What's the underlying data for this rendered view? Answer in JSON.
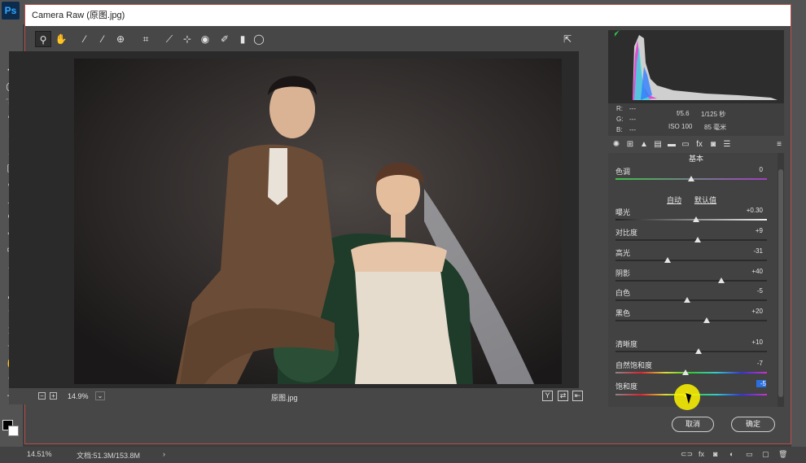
{
  "app": {
    "logo": "Ps",
    "window_title": "Camera Raw (原图.jpg)"
  },
  "ps_status": {
    "zoom": "14.51%",
    "doc": "文档:51.3M/153.8M"
  },
  "toolbar": {
    "icons": [
      "zoom-icon",
      "hand-icon",
      "white-balance-icon",
      "color-sampler-icon",
      "target-adjust-icon",
      "crop-icon",
      "straighten-icon",
      "spot-removal-icon",
      "red-eye-icon",
      "brush-icon",
      "gradient-filter-icon",
      "radial-filter-icon"
    ]
  },
  "status": {
    "zoom_value": "14.9%",
    "filename": "原图.jpg"
  },
  "exif": {
    "r_label": "R:",
    "g_label": "G:",
    "b_label": "B:",
    "dash": "---",
    "aperture": "f/5.6",
    "shutter": "1/125 秒",
    "iso": "ISO 100",
    "focal": "85 毫米"
  },
  "panel": {
    "title": "基本",
    "auto": "自动",
    "default": "默认值",
    "tint": {
      "label": "色调",
      "value": "0",
      "pos": 0.5
    },
    "exposure": {
      "label": "曝光",
      "value": "+0.30",
      "pos": 0.53
    },
    "contrast": {
      "label": "对比度",
      "value": "+9",
      "pos": 0.545
    },
    "highlights": {
      "label": "高光",
      "value": "-31",
      "pos": 0.345
    },
    "shadows": {
      "label": "阴影",
      "value": "+40",
      "pos": 0.7
    },
    "whites": {
      "label": "白色",
      "value": "-5",
      "pos": 0.475
    },
    "blacks": {
      "label": "黑色",
      "value": "+20",
      "pos": 0.6
    },
    "clarity": {
      "label": "清晰度",
      "value": "+10",
      "pos": 0.55
    },
    "vibrance": {
      "label": "自然饱和度",
      "value": "-7",
      "pos": 0.465
    },
    "saturation": {
      "label": "饱和度",
      "value": "-5",
      "pos": 0.475
    }
  },
  "buttons": {
    "cancel": "取消",
    "ok": "确定"
  },
  "colors": {
    "accent": "#2a6fe0",
    "histo_green": "#2fc34a"
  }
}
